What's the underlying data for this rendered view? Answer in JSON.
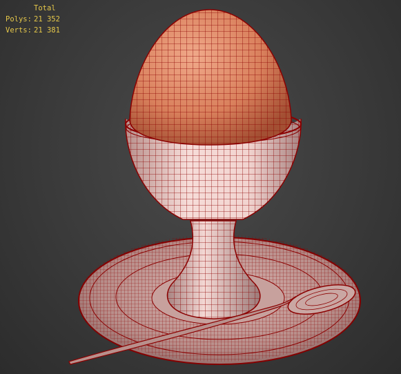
{
  "stats": {
    "header": "Total",
    "polys_label": "Polys:",
    "polys_value": "21 352",
    "verts_label": "Verts:",
    "verts_value": "21 381"
  },
  "colors": {
    "wire": "#8b0000",
    "egg": "#d9805c",
    "egg_dark": "#b85e3e",
    "cup": "#f2d4d0",
    "cup_dark": "#b89a98",
    "background": "#3a3a3a"
  }
}
